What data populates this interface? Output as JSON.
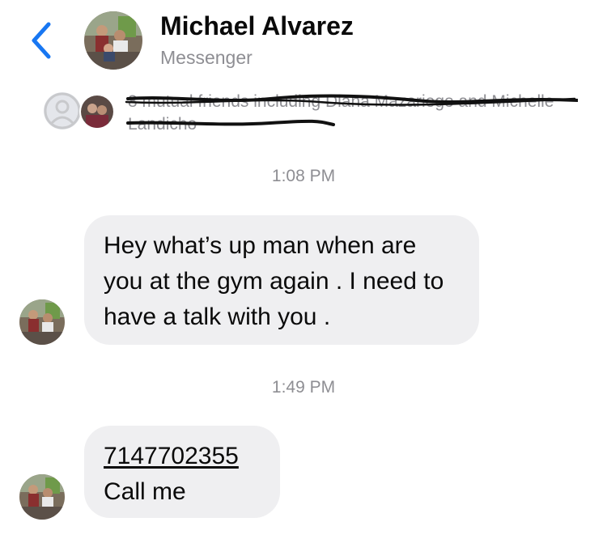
{
  "header": {
    "name": "Michael Alvarez",
    "subtitle": "Messenger",
    "back_icon": "chevron-left-icon",
    "accent_color": "#1877f2"
  },
  "mutual": {
    "text": "8 mutual friends including Diana Mazariego and Michelle Landicho"
  },
  "messages": [
    {
      "time": "1:08 PM",
      "text": "Hey what’s up man when are you at the gym again . I need to have a talk with you ."
    },
    {
      "time": "1:49 PM",
      "phone": "7147702355",
      "text": "Call me"
    }
  ]
}
